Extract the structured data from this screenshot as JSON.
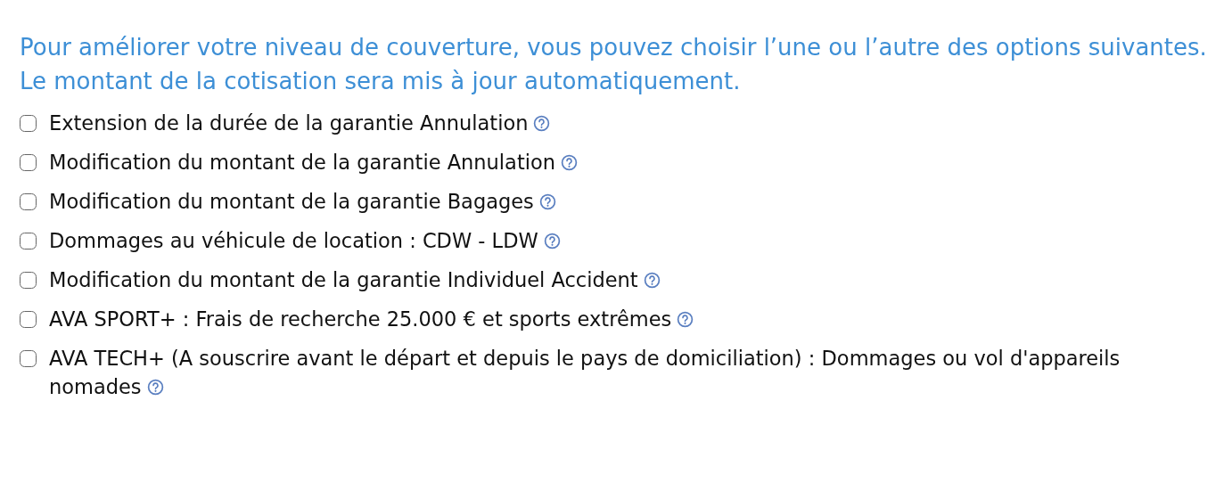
{
  "intro": [
    "Pour améliorer votre niveau de couverture, vous pouvez choisir l’une ou l’autre des options suivantes.",
    "Le montant de la cotisation sera mis à jour automatiquement."
  ],
  "options": [
    {
      "label": "Extension de la durée de la garantie Annulation",
      "checked": false
    },
    {
      "label": "Modification du montant de la garantie Annulation",
      "checked": false
    },
    {
      "label": "Modification du montant de la garantie Bagages",
      "checked": false
    },
    {
      "label": "Dommages au véhicule de location : CDW - LDW",
      "checked": false
    },
    {
      "label": "Modification du montant de la garantie Individuel Accident",
      "checked": false
    },
    {
      "label": "AVA SPORT+ : Frais de recherche 25.000 € et sports extrêmes",
      "checked": false
    },
    {
      "label": "AVA TECH+ (A souscrire avant le départ et depuis le pays de domiciliation) : Dommages ou vol d'appareils nomades",
      "checked": false
    }
  ]
}
